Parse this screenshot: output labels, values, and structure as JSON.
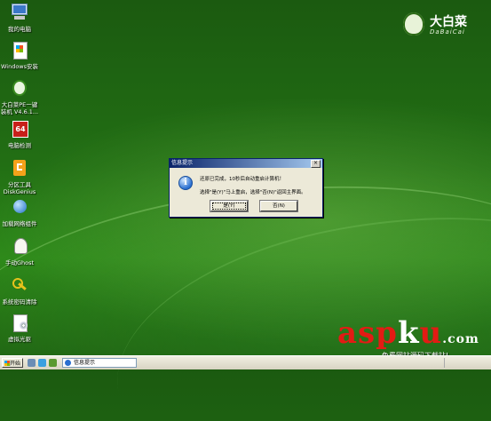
{
  "desktop": {
    "icons": [
      {
        "label": "我的电脑",
        "icon": "computer-icon"
      },
      {
        "label": "Windows安装",
        "icon": "installer-icon"
      },
      {
        "label": "大白菜PE一键装机 V4.6.1...",
        "icon": "install-tool-icon"
      },
      {
        "label": "电脑检测",
        "icon": "hardware-check-icon"
      },
      {
        "label": "分区工具DiskGenius",
        "icon": "partition-tool-icon"
      },
      {
        "label": "加载网络组件",
        "icon": "network-icon"
      },
      {
        "label": "手动Ghost",
        "icon": "ghost-icon"
      },
      {
        "label": "系统密码清除",
        "icon": "key-icon"
      },
      {
        "label": "虚拟光驱",
        "icon": "virtual-drive-icon"
      }
    ]
  },
  "logo": {
    "cn": "大白菜",
    "en": "DaBaiCai"
  },
  "dialog": {
    "title": "信息提示",
    "message1": "还原已完成，10秒后自动重启计算机！",
    "message2": "选择\"是(Y)\"马上重启，选择\"否(N)\"返回主界面。",
    "yes_label": "是(Y)",
    "no_label": "否(N)",
    "close_label": "×"
  },
  "watermark": {
    "brand_red1": "asp",
    "brand_white": "k",
    "brand_red2": "u",
    "tld": ".com",
    "subtitle": "免费网站源码下载站!"
  },
  "taskbar": {
    "start_label": "开始",
    "task_label": "信息提示"
  },
  "colors": {
    "desktop_green": "#226f14",
    "dialog_title_start": "#0a246a",
    "watermark_red": "#e31b14"
  }
}
